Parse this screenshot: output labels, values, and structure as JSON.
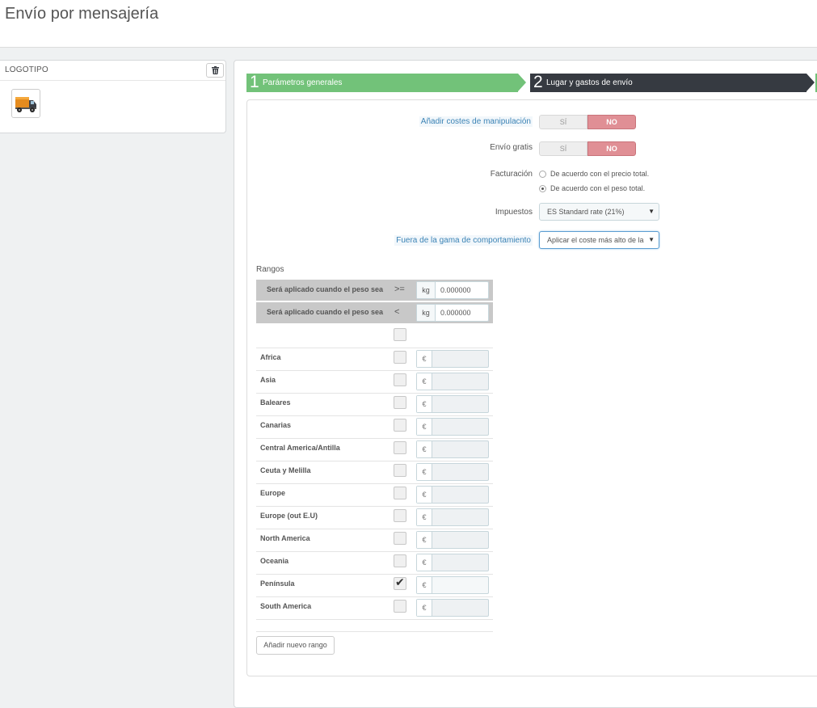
{
  "page": {
    "title": "Envío por mensajería"
  },
  "logo_panel": {
    "title": "LOGOTIPO",
    "delete_icon": "trash-icon",
    "image_icon": "delivery-truck-icon"
  },
  "wizard": {
    "steps": [
      {
        "number": "1",
        "label": "Parámetros generales",
        "color": "#72c279"
      },
      {
        "number": "2",
        "label": "Lugar y gastos de envío",
        "color": "#363a41"
      },
      {
        "number": "",
        "label": "",
        "color": "#72c279"
      }
    ]
  },
  "form": {
    "handling": {
      "label": "Añadir costes de manipulación",
      "yes": "SÍ",
      "no": "NO",
      "value": "NO"
    },
    "free_shipping": {
      "label": "Envío gratis",
      "yes": "SÍ",
      "no": "NO",
      "value": "NO"
    },
    "billing": {
      "label": "Facturación",
      "options": [
        {
          "text": "De acuerdo con el precio total.",
          "selected": false
        },
        {
          "text": "De acuerdo con el peso total.",
          "selected": true
        }
      ]
    },
    "tax": {
      "label": "Impuestos",
      "value": "ES Standard rate (21%)"
    },
    "out_of_range": {
      "label": "Fuera de la gama de comportamiento",
      "value": "Aplicar el coste más alto de la"
    }
  },
  "ranges": {
    "title": "Rangos",
    "conditions": [
      {
        "label": "Será aplicado cuando el peso sea",
        "operator": ">=",
        "unit": "kg",
        "value": "0.000000"
      },
      {
        "label": "Será aplicado cuando el peso sea",
        "operator": "<",
        "unit": "kg",
        "value": "0.000000"
      }
    ],
    "currency": "€",
    "zones": [
      {
        "name": "Africa",
        "checked": false,
        "price": ""
      },
      {
        "name": "Asia",
        "checked": false,
        "price": ""
      },
      {
        "name": "Baleares",
        "checked": false,
        "price": ""
      },
      {
        "name": "Canarias",
        "checked": false,
        "price": ""
      },
      {
        "name": "Central America/Antilla",
        "checked": false,
        "price": ""
      },
      {
        "name": "Ceuta y Melilla",
        "checked": false,
        "price": ""
      },
      {
        "name": "Europe",
        "checked": false,
        "price": ""
      },
      {
        "name": "Europe (out E.U)",
        "checked": false,
        "price": ""
      },
      {
        "name": "North America",
        "checked": false,
        "price": ""
      },
      {
        "name": "Oceania",
        "checked": false,
        "price": ""
      },
      {
        "name": "Península",
        "checked": true,
        "price": ""
      },
      {
        "name": "South America",
        "checked": false,
        "price": ""
      }
    ],
    "add_button": "Añadir nuevo rango"
  }
}
